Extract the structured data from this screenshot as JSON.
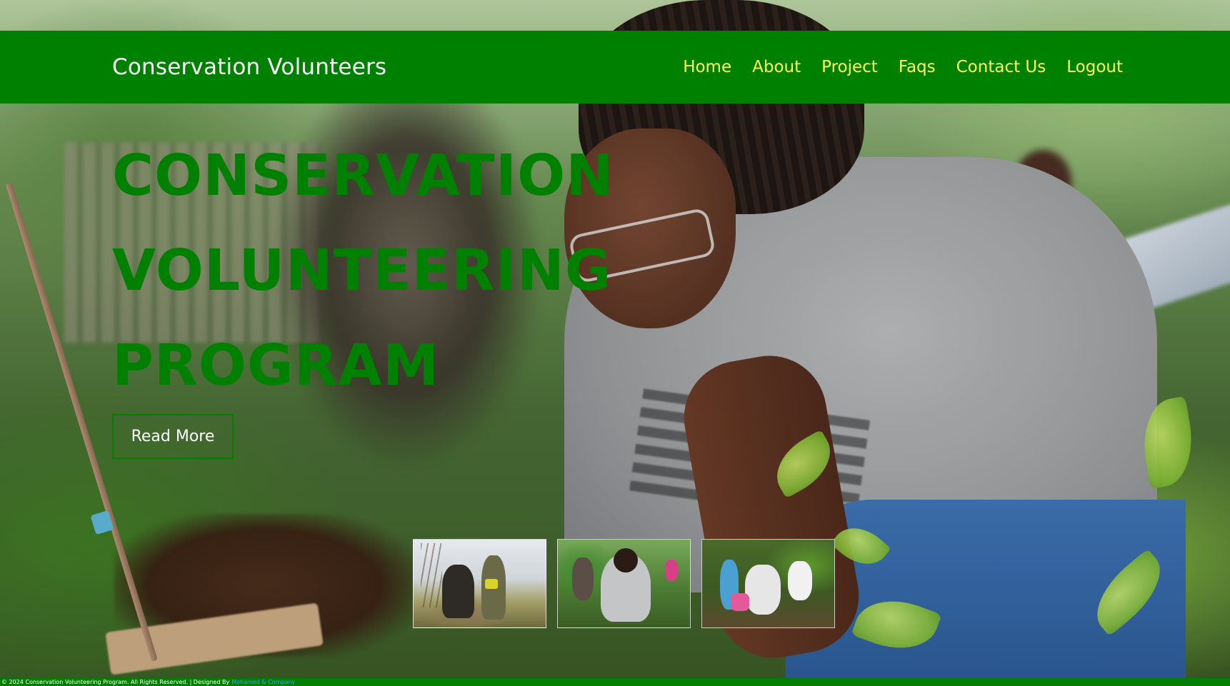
{
  "navbar": {
    "brand": "Conservation Volunteers",
    "links": [
      "Home",
      "About",
      "Project",
      "Faqs",
      "Contact Us",
      "Logout"
    ]
  },
  "hero": {
    "title_lines": [
      "CONSERVATION",
      "VOLUNTEERING",
      "PROGRAM"
    ],
    "button_label": "Read More"
  },
  "thumbnails": [
    {
      "name": "volunteer-photo-watering-tree"
    },
    {
      "name": "volunteer-photo-planting-garden"
    },
    {
      "name": "volunteer-photo-children-planting"
    }
  ],
  "footer": {
    "text": "© 2024 Conservation Volunteering Program. All Rights Reserved. | Designed By",
    "designer": "Mohamed & Company"
  },
  "colors": {
    "primary_green": "#008000",
    "nav_link": "#ffff4d",
    "brand_text": "#ffffff"
  }
}
